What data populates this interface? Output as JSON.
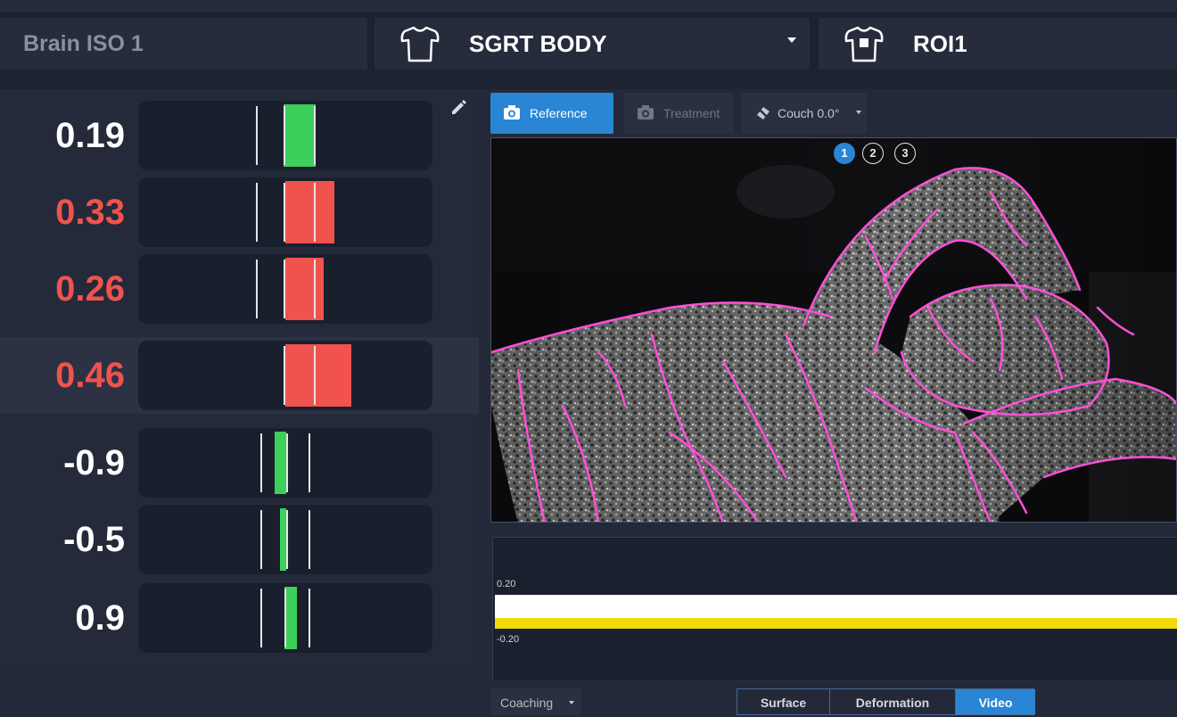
{
  "header": {
    "plan_name": "Brain ISO 1",
    "surface": {
      "label": "SGRT BODY",
      "icon": "torso-outline-icon"
    },
    "roi": {
      "label": "ROI1",
      "icon": "torso-roi-icon"
    }
  },
  "metrics": [
    {
      "value": "0.19",
      "status": "ok"
    },
    {
      "value": "0.33",
      "status": "out"
    },
    {
      "value": "0.26",
      "status": "out"
    },
    {
      "value": "0.46",
      "status": "out"
    },
    {
      "value": "-0.9",
      "status": "ok"
    },
    {
      "value": "-0.5",
      "status": "ok"
    },
    {
      "value": "0.9",
      "status": "ok"
    }
  ],
  "toolbar": {
    "reference_label": "Reference",
    "treatment_label": "Treatment",
    "couch_label": "Couch 0.0°"
  },
  "video": {
    "pages": [
      "1",
      "2",
      "3"
    ],
    "active_page": "1"
  },
  "graph": {
    "upper_label": "0.20",
    "lower_label": "-0.20"
  },
  "bottom": {
    "coaching_label": "Coaching",
    "tabs": [
      "Surface",
      "Deformation",
      "Video"
    ],
    "active_tab": "Video"
  },
  "colors": {
    "accent": "#2a86d4",
    "in_tolerance": "#3ccf5a",
    "out_of_tolerance": "#f0534d",
    "overlay": "#ff4fd8"
  }
}
